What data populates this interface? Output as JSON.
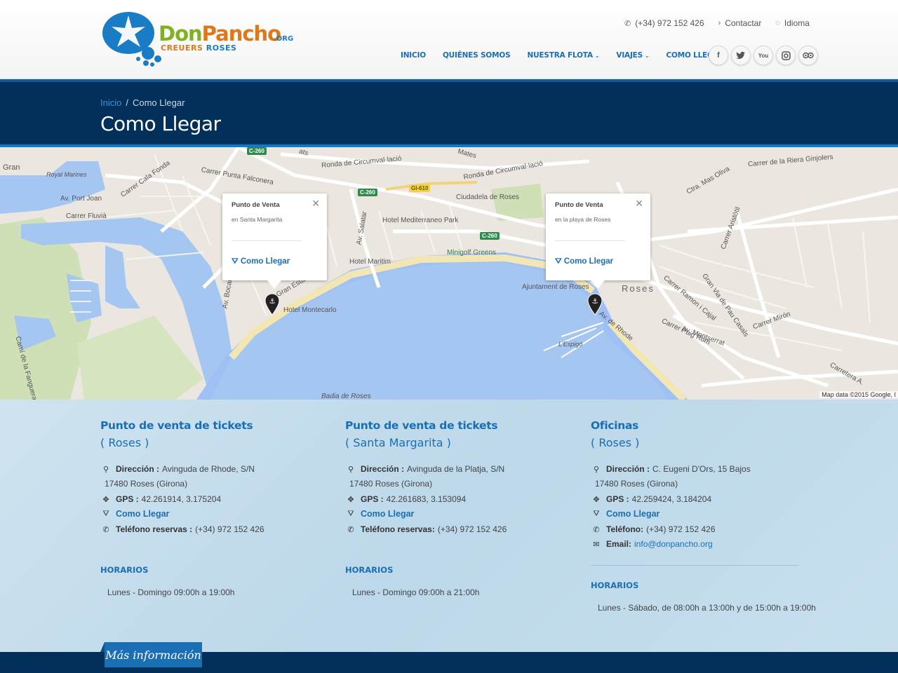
{
  "header": {
    "logo": {
      "name": "Don",
      "name2": "Pancho",
      "tld": ".ORG",
      "sub1": "CREUERS",
      "sub2": "ROSES"
    },
    "phone": "(+34) 972 152 426",
    "contact": "Contactar",
    "language": "Idioma",
    "nav": [
      {
        "label": "INICIO",
        "dropdown": false
      },
      {
        "label": "QUIÉNES SOMOS",
        "dropdown": false
      },
      {
        "label": "NUESTRA FLOTA",
        "dropdown": true
      },
      {
        "label": "VIAJES",
        "dropdown": true
      },
      {
        "label": "COMO LLEGAR",
        "dropdown": false
      }
    ],
    "social": [
      {
        "icon": "facebook-icon",
        "glyph": "f"
      },
      {
        "icon": "twitter-icon",
        "glyph": "🐦"
      },
      {
        "icon": "youtube-icon",
        "glyph": "You"
      },
      {
        "icon": "instagram-icon",
        "glyph": "◙"
      },
      {
        "icon": "tripadvisor-icon",
        "glyph": "◎◎"
      }
    ]
  },
  "breadcrumb": {
    "home": "Inicio",
    "separator": "/",
    "current": "Como Llegar"
  },
  "page_title": "Como Llegar",
  "map": {
    "labels": {
      "gran": "Gran",
      "royal": "Royal Marines",
      "port_joan": "Av. Port Joan",
      "fluvia": "Carrer Fluvià",
      "cala_fonda": "Carrer Cala Fonda",
      "punta_falconera": "Carrer Punta Falconera",
      "circumval1": "Ronda de Circumval·lació",
      "circumval2": "Ronda de Circumval·lació",
      "ciudadela": "Ciudadela de Roses",
      "mas_oliva": "Ctra. Mas Oliva",
      "riera": "Carrer de la Riera Ginjolers",
      "mediterraneo": "Hotel Mediterraneo Park",
      "maritim": "Hotel Maritim",
      "minigolf": "Minigolf Greens",
      "montecarlo": "Hotel Montecarlo",
      "ajuntament": "Ajuntament de Roses",
      "roses": "Roses",
      "rhode": "Av. de Rhode",
      "espigo": "L'Espigó",
      "badia": "Badia de Roses",
      "gran_via": "Gran Via de Pau Casals",
      "miron": "Carrer Mirón",
      "montserrat": "Av. Montserrat",
      "puig_rom": "Carrer Puig Rom",
      "aristotil": "Carrer Aristòtil",
      "carretera": "Carretera A.",
      "cami": "Camí de la Fanguera",
      "salatar": "Av. Salatar",
      "bocana": "Av. Bocana",
      "estany": "Av. Gran Estany",
      "ramon": "Carrer Ramon i Cajal",
      "mates": "Mates",
      "ats": "ats"
    },
    "roads": {
      "c260a": "C-260",
      "c260b": "C-260",
      "c260c": "C-260",
      "gi610": "GI-610"
    },
    "credit": "Map data ©2015 Google, I",
    "popups": [
      {
        "title": "Punto de Venta",
        "subtitle": "en Santa Margarita",
        "link": "Como Llegar"
      },
      {
        "title": "Punto de Venta",
        "subtitle": "en la playa de Roses",
        "link": "Como Llegar"
      }
    ]
  },
  "locations": [
    {
      "title": "Punto de venta de tickets",
      "city": "( Roses )",
      "address_label": "Dirección :",
      "address": "Avinguda de Rhode, S/N",
      "address2": "17480 Roses (Girona)",
      "gps_label": "GPS :",
      "gps": "42.261914, 3.175204",
      "directions": "Como Llegar",
      "phone_label": "Teléfono reservas :",
      "phone": "(+34) 972 152 426",
      "hours_title": "HORARIOS",
      "hours": "Lunes - Domingo 09:00h a 19:00h"
    },
    {
      "title": "Punto de venta de tickets",
      "city": "( Santa Margarita )",
      "address_label": "Dirección :",
      "address": "Avinguda de la Platja, S/N",
      "address2": "17480 Roses (Girona)",
      "gps_label": "GPS :",
      "gps": "42.261683, 3.153094",
      "directions": "Como Llegar",
      "phone_label": "Teléfono reservas:",
      "phone": "(+34) 972 152 426",
      "hours_title": "HORARIOS",
      "hours": "Lunes - Domingo 09:00h a 21:00h"
    },
    {
      "title": "Oficinas",
      "city": "( Roses )",
      "address_label": "Dirección :",
      "address": "C. Eugeni D'Ors, 15 Bajos",
      "address2": "17480 Roses (Girona)",
      "gps_label": "GPS :",
      "gps": "42.259424, 3.184204",
      "directions": "Como Llegar",
      "phone_label": "Teléfono:",
      "phone": "(+34) 972 152 426",
      "email_label": "Email:",
      "email": "info@donpancho.org",
      "hours_title": "HORARIOS",
      "hours": "Lunes - Sábado, de 08:00h a 13:00h y de 15:00h a 19:00h"
    }
  ],
  "more_info": "Más información",
  "colors": {
    "brand_blue": "#1a6fb4",
    "navy": "#03305a",
    "logo_green": "#7fb31e",
    "logo_orange": "#e0781a"
  }
}
